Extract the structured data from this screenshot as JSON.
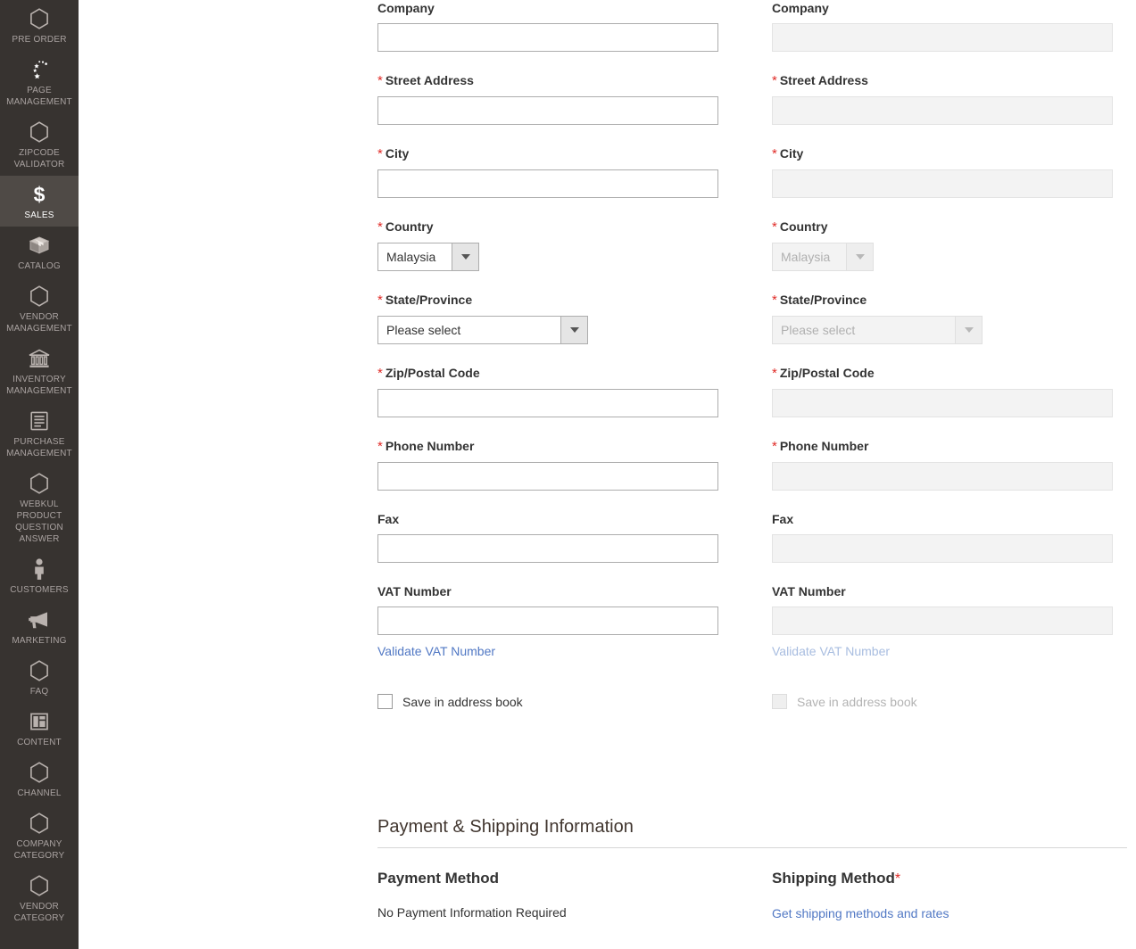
{
  "sidebar": {
    "items": [
      {
        "label": "PRE ORDER",
        "icon": "hexagon-icon",
        "active": false
      },
      {
        "label": "PAGE\nMANAGEMENT",
        "icon": "sparkle-spinner-icon",
        "active": false
      },
      {
        "label": "ZIPCODE\nVALIDATOR",
        "icon": "hexagon-icon",
        "active": false
      },
      {
        "label": "SALES",
        "icon": "dollar-icon",
        "active": true
      },
      {
        "label": "CATALOG",
        "icon": "box-icon",
        "active": false
      },
      {
        "label": "VENDOR\nMANAGEMENT",
        "icon": "hexagon-icon",
        "active": false
      },
      {
        "label": "INVENTORY\nMANAGEMENT",
        "icon": "bank-icon",
        "active": false
      },
      {
        "label": "PURCHASE\nMANAGEMENT",
        "icon": "document-icon",
        "active": false
      },
      {
        "label": "WEBKUL\nPRODUCT\nQUESTION\nANSWER",
        "icon": "hexagon-icon",
        "active": false
      },
      {
        "label": "CUSTOMERS",
        "icon": "person-icon",
        "active": false
      },
      {
        "label": "MARKETING",
        "icon": "megaphone-icon",
        "active": false
      },
      {
        "label": "FAQ",
        "icon": "hexagon-icon",
        "active": false
      },
      {
        "label": "CONTENT",
        "icon": "layout-icon",
        "active": false
      },
      {
        "label": "CHANNEL",
        "icon": "hexagon-icon",
        "active": false
      },
      {
        "label": "COMPANY\nCATEGORY",
        "icon": "hexagon-icon",
        "active": false
      },
      {
        "label": "VENDOR\nCATEGORY",
        "icon": "hexagon-icon",
        "active": false
      }
    ]
  },
  "colors": {
    "sidebar_bg": "#373330",
    "sidebar_active_bg": "#4f4a46",
    "required_red": "#e02b27",
    "link_blue": "#5178c4",
    "disabled_bg": "#f3f3f3"
  },
  "billing": {
    "company": {
      "label": "Company",
      "value": "",
      "required": false
    },
    "street": {
      "label": "Street Address",
      "value": "",
      "required": true
    },
    "city": {
      "label": "City",
      "value": "",
      "required": true
    },
    "country": {
      "label": "Country",
      "value": "Malaysia",
      "required": true
    },
    "state": {
      "label": "State/Province",
      "value": "Please select",
      "required": true
    },
    "zip": {
      "label": "Zip/Postal Code",
      "value": "",
      "required": true
    },
    "phone": {
      "label": "Phone Number",
      "value": "",
      "required": true
    },
    "fax": {
      "label": "Fax",
      "value": "",
      "required": false
    },
    "vat": {
      "label": "VAT Number",
      "value": "",
      "required": false
    },
    "validate_vat_link": "Validate VAT Number",
    "save_address_label": "Save in address book",
    "save_address_checked": false
  },
  "shipping": {
    "company": {
      "label": "Company",
      "value": "",
      "required": false
    },
    "street": {
      "label": "Street Address",
      "value": "",
      "required": true
    },
    "city": {
      "label": "City",
      "value": "",
      "required": true
    },
    "country": {
      "label": "Country",
      "value": "Malaysia",
      "required": true
    },
    "state": {
      "label": "State/Province",
      "value": "Please select",
      "required": true
    },
    "zip": {
      "label": "Zip/Postal Code",
      "value": "",
      "required": true
    },
    "phone": {
      "label": "Phone Number",
      "value": "",
      "required": true
    },
    "fax": {
      "label": "Fax",
      "value": "",
      "required": false
    },
    "vat": {
      "label": "VAT Number",
      "value": "",
      "required": false
    },
    "validate_vat_link": "Validate VAT Number",
    "save_address_label": "Save in address book",
    "save_address_checked": false
  },
  "payment_shipping": {
    "section_title": "Payment & Shipping Information",
    "payment_method_heading": "Payment Method",
    "payment_method_text": "No Payment Information Required",
    "shipping_method_heading": "Shipping Method",
    "shipping_method_required_mark": "*",
    "shipping_methods_link": "Get shipping methods and rates"
  },
  "required_marker": "*"
}
